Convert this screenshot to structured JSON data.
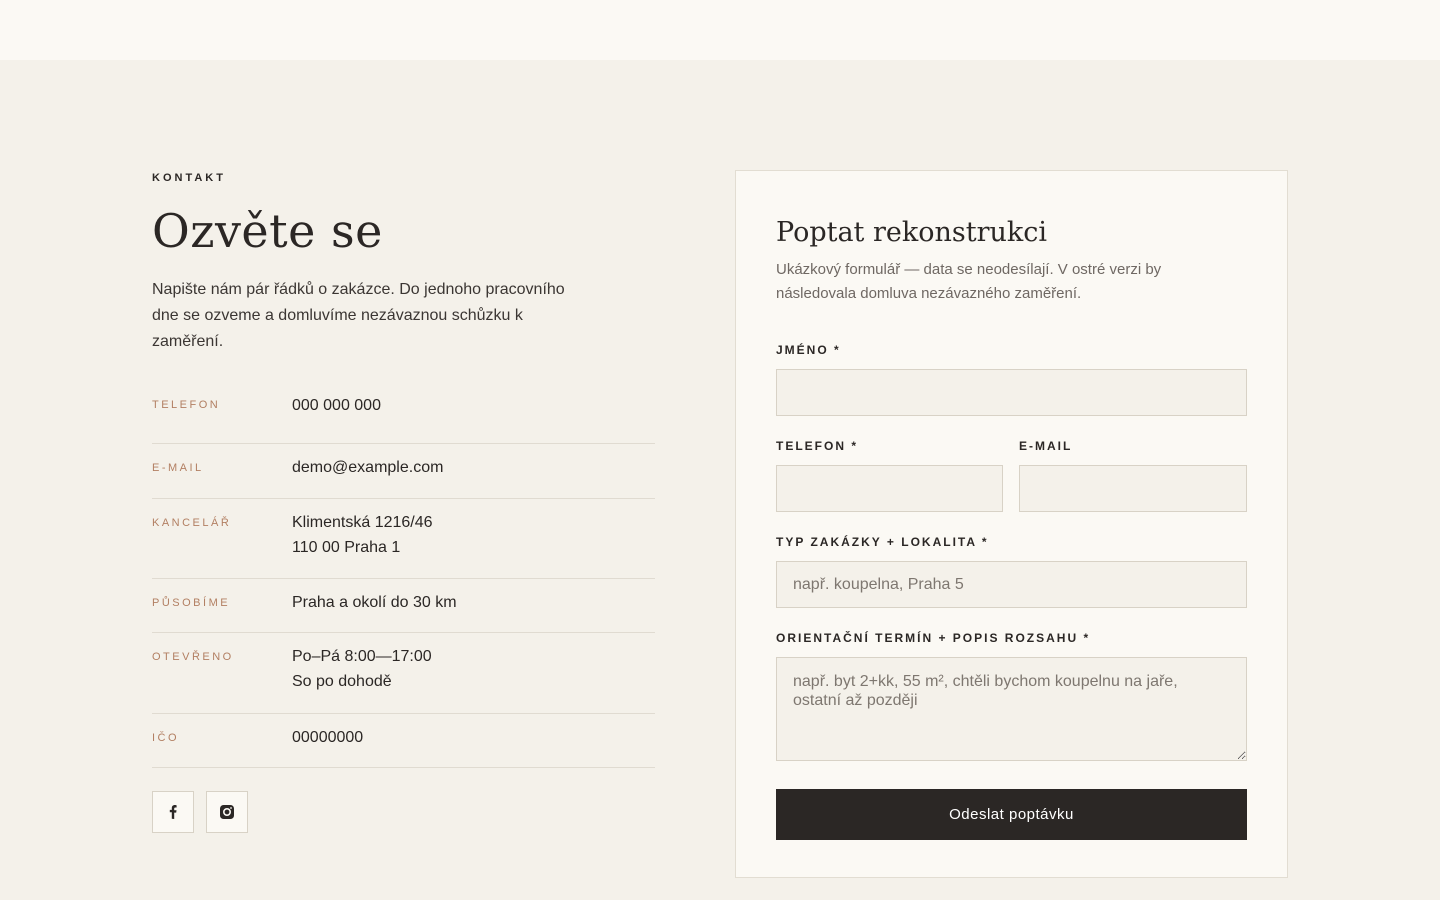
{
  "contact": {
    "eyebrow": "KONTAKT",
    "title": "Ozvěte se",
    "intro": "Napište nám pár řádků o zakázce. Do jednoho pracovního dne se ozveme a domluvíme nezávaznou schůzku k zaměření.",
    "info": [
      {
        "label": "TELEFON",
        "lines": [
          "000 000 000"
        ]
      },
      {
        "label": "E-MAIL",
        "lines": [
          "demo@example.com"
        ]
      },
      {
        "label": "KANCELÁŘ",
        "lines": [
          "Klimentská 1216/46",
          "110 00 Praha 1"
        ]
      },
      {
        "label": "PŮSOBÍME",
        "lines": [
          "Praha a okolí do 30 km"
        ]
      },
      {
        "label": "OTEVŘENO",
        "lines": [
          "Po–Pá 8:00—17:00",
          "So po dohodě"
        ]
      },
      {
        "label": "IČO",
        "lines": [
          "00000000"
        ]
      }
    ],
    "socials": [
      "facebook-icon",
      "instagram-icon"
    ]
  },
  "form": {
    "title": "Poptat rekonstrukci",
    "description": "Ukázkový formulář — data se neodesílají. V ostré verzi by následovala domluva nezávazného zaměření.",
    "name_label": "JMÉNO *",
    "name_value": "",
    "phone_label": "TELEFON *",
    "phone_value": "",
    "email_label": "E-MAIL",
    "email_value": "",
    "type_label": "TYP ZAKÁZKY + LOKALITA *",
    "type_placeholder": "např. koupelna, Praha 5",
    "scope_label": "ORIENTAČNÍ TERMÍN + POPIS ROZSAHU *",
    "scope_placeholder": "např. byt 2+kk, 55 m², chtěli bychom koupelnu na jaře, ostatní až později",
    "submit_label": "Odeslat poptávku"
  },
  "colors": {
    "page_bg": "#f4f1ea",
    "card_bg": "#fbf9f4",
    "accent_label": "#b27f62",
    "button_bg": "#2b2725"
  }
}
